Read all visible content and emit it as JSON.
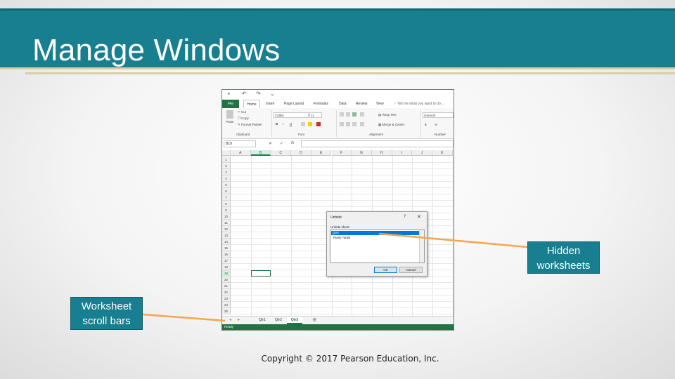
{
  "slide": {
    "title": "Manage Windows",
    "copyright": "Copyright © 2017 Pearson Education, Inc.",
    "accent_color": "#177f8f",
    "callouts": {
      "hidden_worksheets": "Hidden worksheets",
      "worksheet_scroll_bars": "Worksheet scroll bars"
    }
  },
  "excel": {
    "qat": {
      "save_icon": "save-icon",
      "undo_icon": "undo-icon",
      "redo_icon": "redo-icon"
    },
    "tabs": [
      "File",
      "Home",
      "Insert",
      "Page Layout",
      "Formulas",
      "Data",
      "Review",
      "View"
    ],
    "tell_me": "Tell me what you want to do...",
    "ribbon": {
      "paste": "Paste",
      "cut": "Cut",
      "copy": "Copy",
      "format_painter": "Format Painter",
      "clipboard": "Clipboard",
      "font_name": "Calibri",
      "font_size": "11",
      "bold": "B",
      "italic": "I",
      "underline": "U",
      "font": "Font",
      "wrap_text": "Wrap Text",
      "merge_center": "Merge & Center",
      "alignment": "Alignment",
      "number_format": "General",
      "currency": "$",
      "percent": "%",
      "number": "Number"
    },
    "name_box": "B19",
    "fx": "fx",
    "columns": [
      "A",
      "B",
      "C",
      "D",
      "E",
      "F",
      "G",
      "H",
      "I",
      "J",
      "K"
    ],
    "rows": [
      "1",
      "2",
      "3",
      "4",
      "5",
      "6",
      "7",
      "8",
      "9",
      "10",
      "11",
      "12",
      "13",
      "14",
      "15",
      "16",
      "17",
      "18",
      "19",
      "20",
      "21",
      "22",
      "23",
      "24",
      "25"
    ],
    "selected_column": "B",
    "selected_row": "19",
    "sheets": [
      "Qtr1",
      "Qtr2",
      "Qtr3"
    ],
    "active_sheet": "Qtr3",
    "add_sheet": "⊕",
    "status": "Ready",
    "dialog": {
      "title": "Unhide",
      "help": "?",
      "close": "✕",
      "label": "Unhide sheet:",
      "options": [
        "Qtr4",
        "Yearly Totals"
      ],
      "selected_option": "Qtr4",
      "ok": "OK",
      "cancel": "Cancel"
    }
  }
}
